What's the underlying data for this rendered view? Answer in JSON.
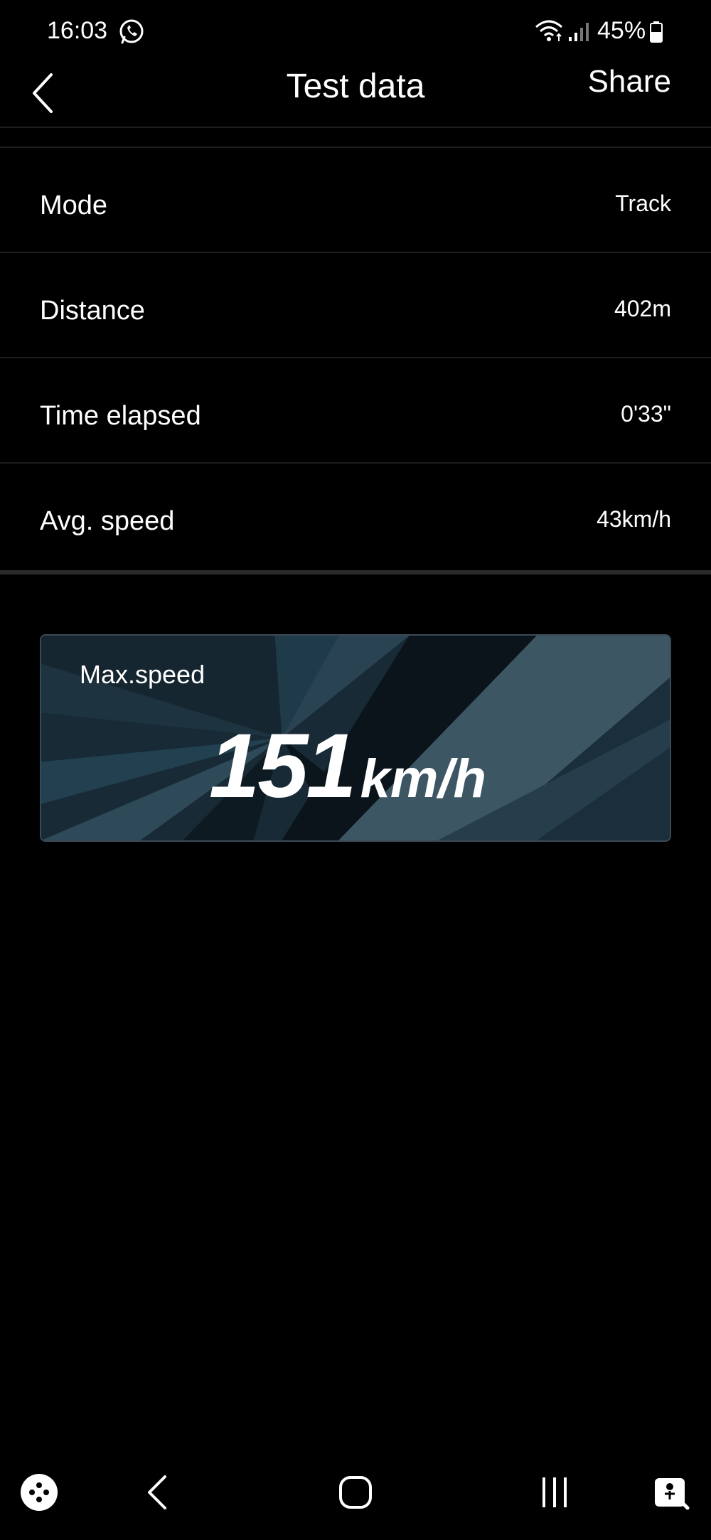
{
  "status_bar": {
    "time": "16:03",
    "battery": "45%"
  },
  "header": {
    "title": "Test data",
    "share_label": "Share"
  },
  "rows": [
    {
      "label": "Mode",
      "value": "Track"
    },
    {
      "label": "Distance",
      "value": "402m"
    },
    {
      "label": "Time elapsed",
      "value": "0'33\""
    },
    {
      "label": "Avg. speed",
      "value": "43km/h"
    }
  ],
  "max_speed": {
    "label": "Max.speed",
    "value": "151",
    "unit": "km/h"
  },
  "icons": {
    "status": [
      "whatsapp-icon",
      "wifi-icon",
      "signal-icon",
      "battery-icon"
    ],
    "nav": [
      "game-launcher-icon",
      "back-icon",
      "home-icon",
      "recents-icon",
      "accessibility-icon"
    ]
  },
  "colors": {
    "background": "#000000",
    "text": "#ffffff",
    "card_background": "#15242e"
  }
}
